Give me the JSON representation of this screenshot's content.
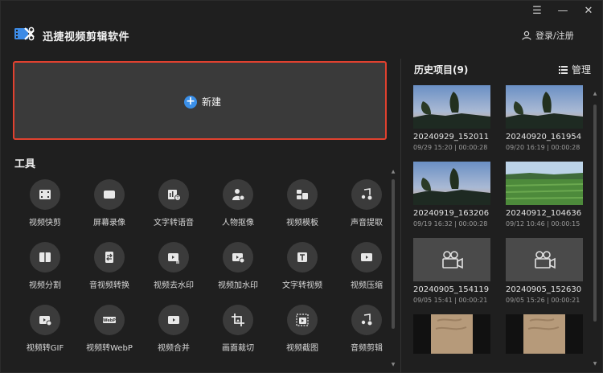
{
  "app": {
    "title": "迅捷视频剪辑软件",
    "login_label": "登录/注册"
  },
  "window_controls": {
    "menu": "☰",
    "minimize": "—",
    "close": "✕"
  },
  "new_project": {
    "label": "新建"
  },
  "tools": {
    "title": "工具",
    "items": [
      {
        "label": "视频快剪",
        "icon": "film-icon"
      },
      {
        "label": "屏幕录像",
        "icon": "screen-record-icon"
      },
      {
        "label": "文字转语音",
        "icon": "text-to-speech-icon"
      },
      {
        "label": "人物抠像",
        "icon": "person-cutout-icon"
      },
      {
        "label": "视频模板",
        "icon": "template-icon"
      },
      {
        "label": "声音提取",
        "icon": "music-extract-icon"
      },
      {
        "label": "视频分割",
        "icon": "split-icon"
      },
      {
        "label": "音视频转换",
        "icon": "convert-icon"
      },
      {
        "label": "视频去水印",
        "icon": "remove-watermark-icon"
      },
      {
        "label": "视频加水印",
        "icon": "add-watermark-icon"
      },
      {
        "label": "文字转视频",
        "icon": "text-to-video-icon"
      },
      {
        "label": "视频压缩",
        "icon": "compress-icon"
      },
      {
        "label": "视频转GIF",
        "icon": "gif-icon"
      },
      {
        "label": "视频转WebP",
        "icon": "webp-icon"
      },
      {
        "label": "视频合并",
        "icon": "merge-icon"
      },
      {
        "label": "画面裁切",
        "icon": "crop-icon"
      },
      {
        "label": "视频截图",
        "icon": "screenshot-icon"
      },
      {
        "label": "音频剪辑",
        "icon": "audio-edit-icon"
      }
    ]
  },
  "history": {
    "title": "历史项目(9)",
    "manage_label": "管理",
    "projects": [
      {
        "name": "20240929_152011",
        "meta": "09/29 15:20 | 00:00:28",
        "thumb": "sunset"
      },
      {
        "name": "20240920_161954",
        "meta": "09/20 16:19 | 00:00:28",
        "thumb": "sunset"
      },
      {
        "name": "20240919_163206",
        "meta": "09/19 16:32 | 00:00:28",
        "thumb": "sunset"
      },
      {
        "name": "20240912_104636",
        "meta": "09/12 10:46 | 00:00:15",
        "thumb": "field"
      },
      {
        "name": "20240905_154119",
        "meta": "09/05 15:41 | 00:00:21",
        "thumb": "placeholder"
      },
      {
        "name": "20240905_152630",
        "meta": "09/05 15:26 | 00:00:21",
        "thumb": "placeholder"
      },
      {
        "name": "",
        "meta": "",
        "thumb": "sand"
      },
      {
        "name": "",
        "meta": "",
        "thumb": "sand"
      }
    ]
  },
  "colors": {
    "accent_border": "#e0412f",
    "plus_blue": "#3a8fe8",
    "background": "#1f1f1f"
  }
}
